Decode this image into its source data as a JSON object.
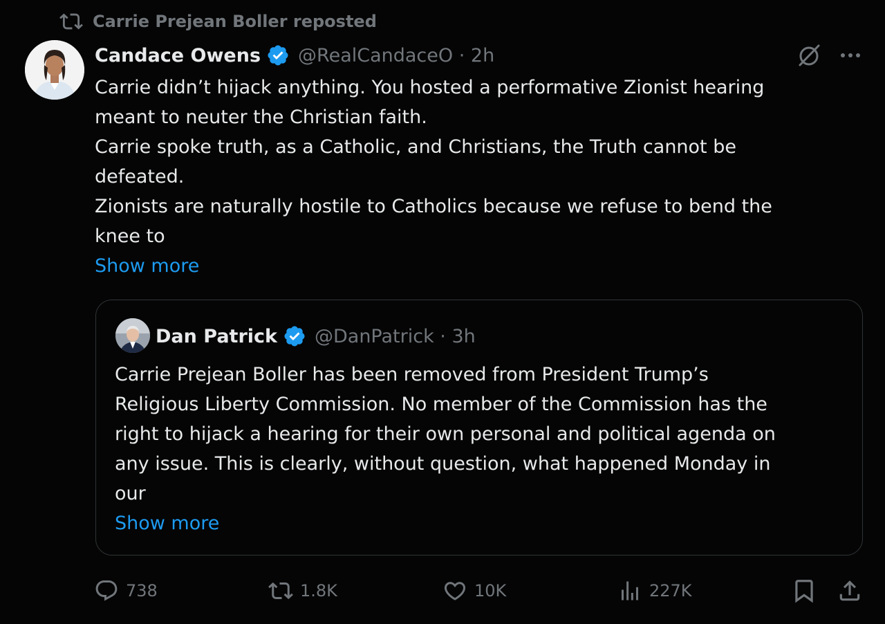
{
  "repost": {
    "text": "Carrie Prejean Boller reposted"
  },
  "tweet": {
    "author_name": "Candace Owens",
    "handle_time": "@RealCandaceO · 2h",
    "lines": [
      "Carrie didn’t hijack anything. You hosted a performative Zionist hearing",
      "meant to neuter the Christian faith.",
      "Carrie spoke truth, as a Catholic, and Christians, the Truth cannot be",
      "defeated.",
      "Zionists are naturally hostile to Catholics because we refuse to bend the",
      "knee to"
    ],
    "show_more": "Show more"
  },
  "quote": {
    "author_name": "Dan Patrick",
    "handle_time": "@DanPatrick · 3h",
    "lines": [
      "Carrie Prejean Boller has been removed from President Trump’s",
      "Religious Liberty Commission. No member of the Commission has the",
      "right to hijack a hearing for their own personal and political agenda on",
      "any issue. This is clearly, without question, what happened Monday in",
      "our"
    ],
    "show_more": "Show more"
  },
  "actions": {
    "replies": "738",
    "reposts": "1.8K",
    "likes": "10K",
    "views": "227K"
  },
  "colors": {
    "background": "#050505",
    "text": "#e7e9ea",
    "muted": "#71767b",
    "accent": "#1d9bf0",
    "border": "#2f3336"
  },
  "icons": [
    "repost-icon",
    "verified-badge-icon",
    "grok-icon",
    "more-icon",
    "reply-icon",
    "like-icon",
    "views-icon",
    "bookmark-icon",
    "share-icon"
  ]
}
